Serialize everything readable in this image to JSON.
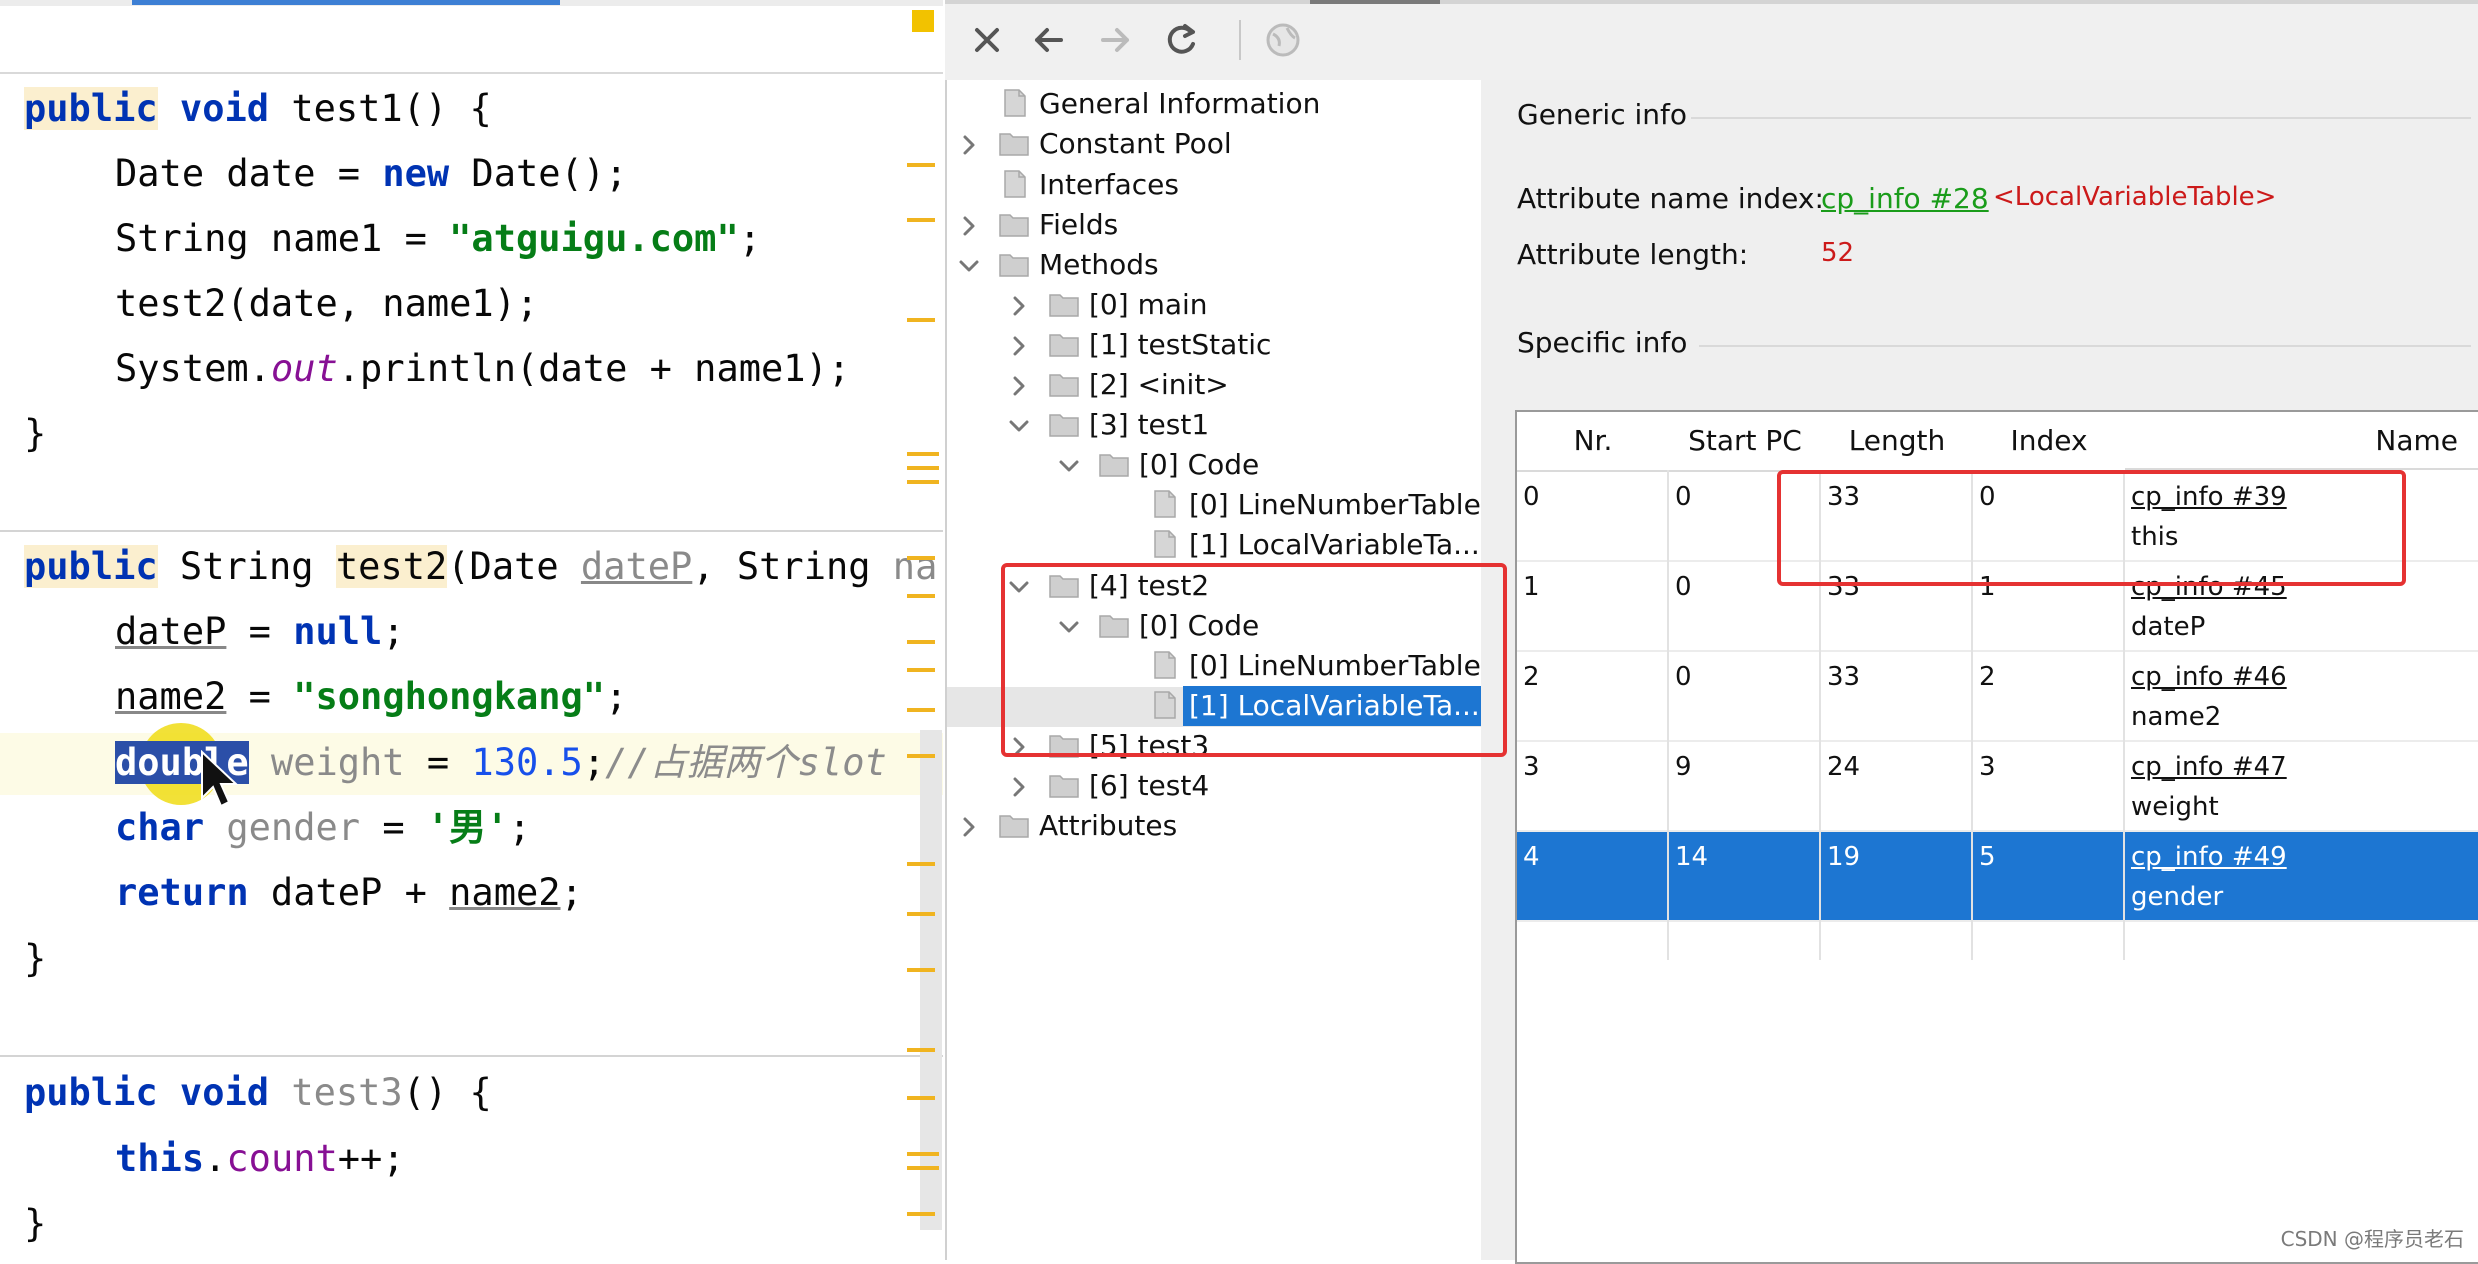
{
  "editor": {
    "method1": {
      "sig_kw1": "public",
      "sig_kw2": " void",
      "sig_rest": " test1() {",
      "l1_a": "Date date = ",
      "l1_kw": "new",
      "l1_b": " Date();",
      "l2_a": "String name1 = ",
      "l2_str": "\"atguigu.com\"",
      "l2_b": ";",
      "l3": "test2(date, name1);",
      "l4_a": "System.",
      "l4_fld": "out",
      "l4_b": ".println(date + name1);",
      "close": "}"
    },
    "method2": {
      "sig_kw1": "public",
      "sig_a": " String ",
      "sig_name": "test2",
      "sig_b": "(Date ",
      "sig_p1": "dateP",
      "sig_c": ", String ",
      "sig_p2": "na",
      "l1_a": "dateP",
      "l1_b": " = ",
      "l1_kw": "null",
      "l1_c": ";",
      "l2_a": "name2",
      "l2_b": " = ",
      "l2_str": "\"songhongkang\"",
      "l2_c": ";",
      "l3_kw": "double",
      "l3_a": " weight",
      "l3_b": " = ",
      "l3_num": "130.5",
      "l3_c": ";",
      "l3_cmt": "//占据两个slot",
      "l4_kw": "char",
      "l4_a": " gender",
      "l4_b": " = ",
      "l4_str": "'男'",
      "l4_c": ";",
      "l5_kw": "return",
      "l5_a": " dateP + ",
      "l5_b": "name2",
      "l5_c": ";",
      "close": "}"
    },
    "method3": {
      "sig_kw1": "public",
      "sig_kw2": " void",
      "sig_name": " test3",
      "sig_rest": "() {",
      "l1_kw": "this",
      "l1_a": ".",
      "l1_fld": "count",
      "l1_b": "++;",
      "close": "}"
    }
  },
  "tree": {
    "items": [
      {
        "label": "General Information"
      },
      {
        "label": "Constant Pool"
      },
      {
        "label": "Interfaces"
      },
      {
        "label": "Fields"
      },
      {
        "label": "Methods"
      },
      {
        "label": "[0] main"
      },
      {
        "label": "[1] testStatic"
      },
      {
        "label": "[2] <init>"
      },
      {
        "label": "[3] test1"
      },
      {
        "label": "[0] Code"
      },
      {
        "label": "[0] LineNumberTable"
      },
      {
        "label": "[1] LocalVariableTa..."
      },
      {
        "label": "[4] test2"
      },
      {
        "label": "[0] Code"
      },
      {
        "label": "[0] LineNumberTable"
      },
      {
        "label": "[1] LocalVariableTa..."
      },
      {
        "label": "[5] test3"
      },
      {
        "label": "[6] test4"
      },
      {
        "label": "Attributes"
      }
    ]
  },
  "right": {
    "generic_title": "Generic info",
    "attr_name_label": "Attribute name index:",
    "attr_name_link": "cp_info #28",
    "attr_name_value": "<LocalVariableTable>",
    "attr_len_label": "Attribute length:",
    "attr_len_value": "52",
    "specific_title": "Specific info",
    "table": {
      "headers": [
        "Nr.",
        "Start PC",
        "Length",
        "Index",
        "Name"
      ],
      "rows": [
        {
          "nr": "0",
          "start": "0",
          "length": "33",
          "index": "0",
          "link": "cp_info #39",
          "name": "this"
        },
        {
          "nr": "1",
          "start": "0",
          "length": "33",
          "index": "1",
          "link": "cp_info #45",
          "name": "dateP"
        },
        {
          "nr": "2",
          "start": "0",
          "length": "33",
          "index": "2",
          "link": "cp_info #46",
          "name": "name2"
        },
        {
          "nr": "3",
          "start": "9",
          "length": "24",
          "index": "3",
          "link": "cp_info #47",
          "name": "weight"
        },
        {
          "nr": "4",
          "start": "14",
          "length": "19",
          "index": "5",
          "link": "cp_info #49",
          "name": "gender"
        }
      ]
    }
  },
  "watermark": "CSDN @程序员老石",
  "colors": {
    "accent": "#1d76d2",
    "link": "#1a9c1a",
    "highlight_box": "#e53232",
    "keyword": "#0033b3",
    "string": "#067d17"
  }
}
